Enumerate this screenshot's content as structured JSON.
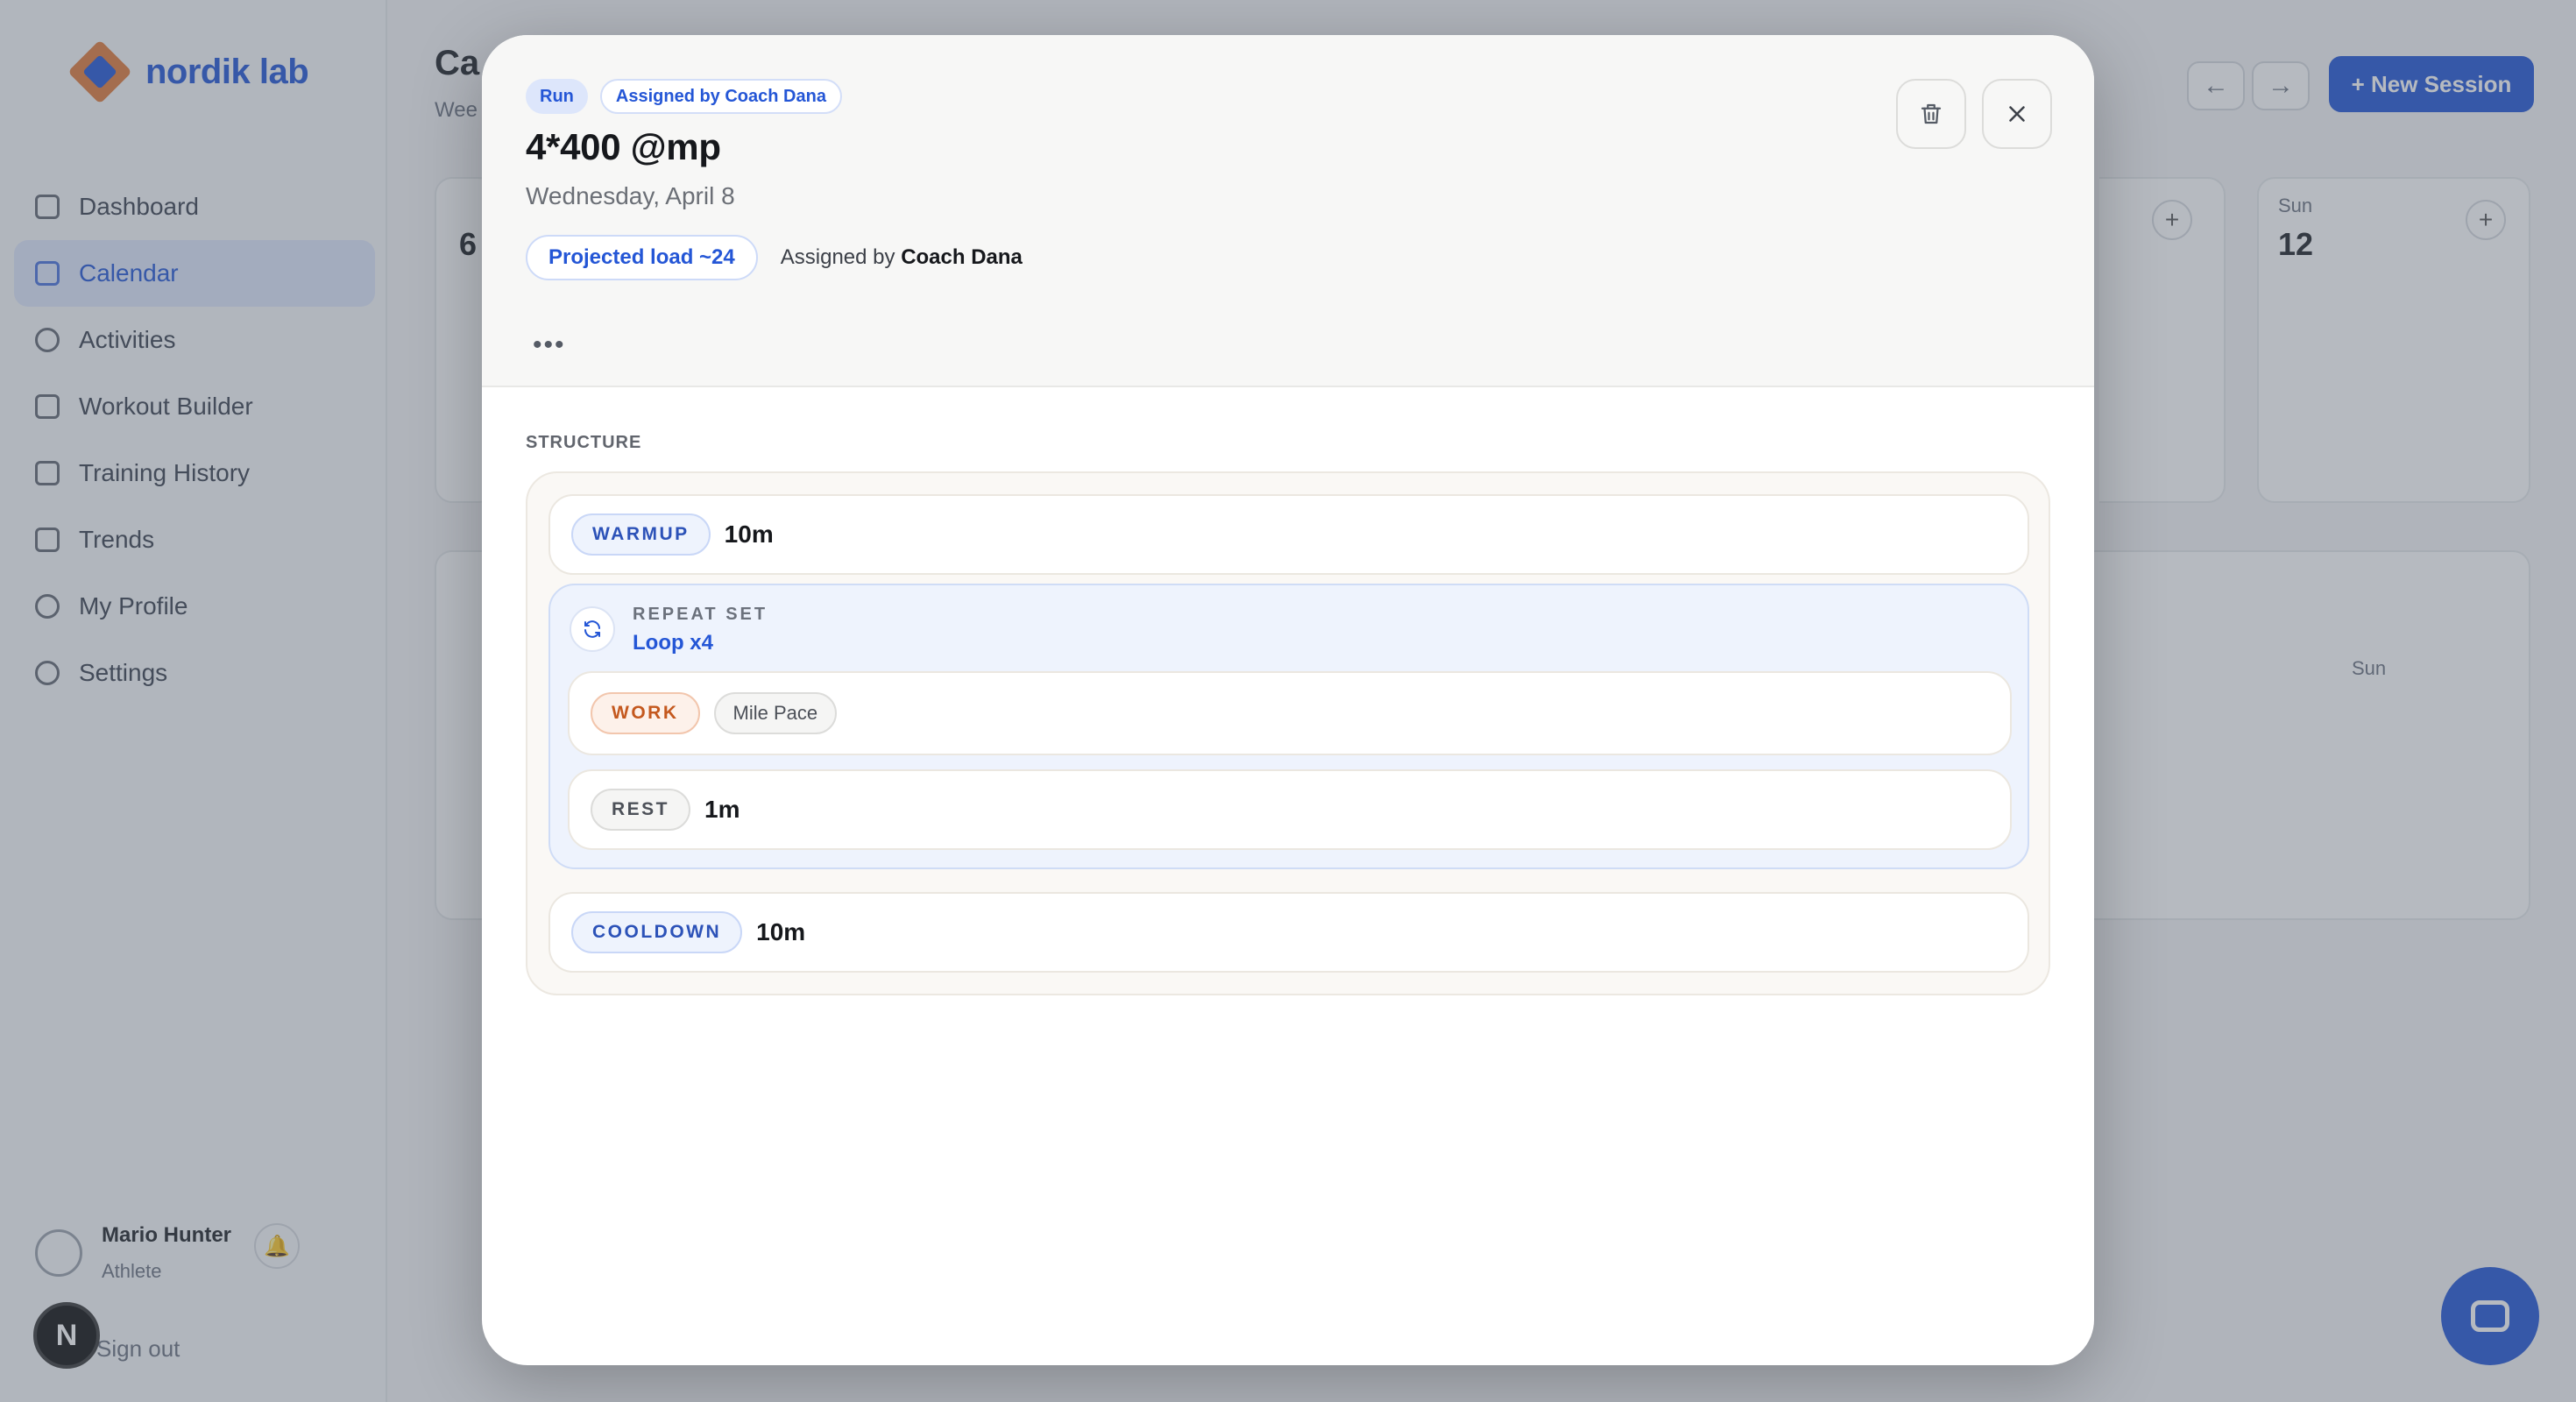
{
  "app": {
    "logo_text": "nordik lab",
    "page_title": "Ca",
    "page_subtitle": "Wee",
    "nav": [
      {
        "label": "Dashboard",
        "icon": "dashboard-icon"
      },
      {
        "label": "Calendar",
        "icon": "calendar-icon"
      },
      {
        "label": "Activities",
        "icon": "activity-icon"
      },
      {
        "label": "Workout Builder",
        "icon": "link-icon"
      },
      {
        "label": "Training History",
        "icon": "history-icon"
      },
      {
        "label": "Trends",
        "icon": "trends-icon"
      },
      {
        "label": "My Profile",
        "icon": "user-icon"
      },
      {
        "label": "Settings",
        "icon": "gear-icon"
      }
    ],
    "user": {
      "name": "Mario Hunter",
      "role": "Athlete"
    },
    "signout_label": "Sign out",
    "n_badge": "N",
    "prev_arrow": "←",
    "next_arrow": "→",
    "new_session_label": "+  New Session",
    "days": [
      {
        "label": "Sun",
        "number": "12"
      }
    ],
    "partial_day_number": "6",
    "week_day_label": "Sun",
    "accent_color": "#2456d6"
  },
  "modal": {
    "tags": [
      "Run",
      "Assigned by Coach Dana"
    ],
    "title": "4*400 @mp",
    "date": "Wednesday, April 8",
    "projected_load": "Projected load ~24",
    "assigned_prefix": "Assigned by",
    "assigned_coach": "Coach Dana",
    "more_label": "•••",
    "section_label": "STRUCTURE",
    "warmup": {
      "tag": "WARMUP",
      "value": "10m"
    },
    "repeat": {
      "label": "REPEAT SET",
      "value": "Loop x4",
      "work": {
        "tag": "WORK",
        "pace": "Mile Pace"
      },
      "rest": {
        "tag": "REST",
        "value": "1m"
      }
    },
    "cooldown": {
      "tag": "COOLDOWN",
      "value": "10m"
    }
  }
}
